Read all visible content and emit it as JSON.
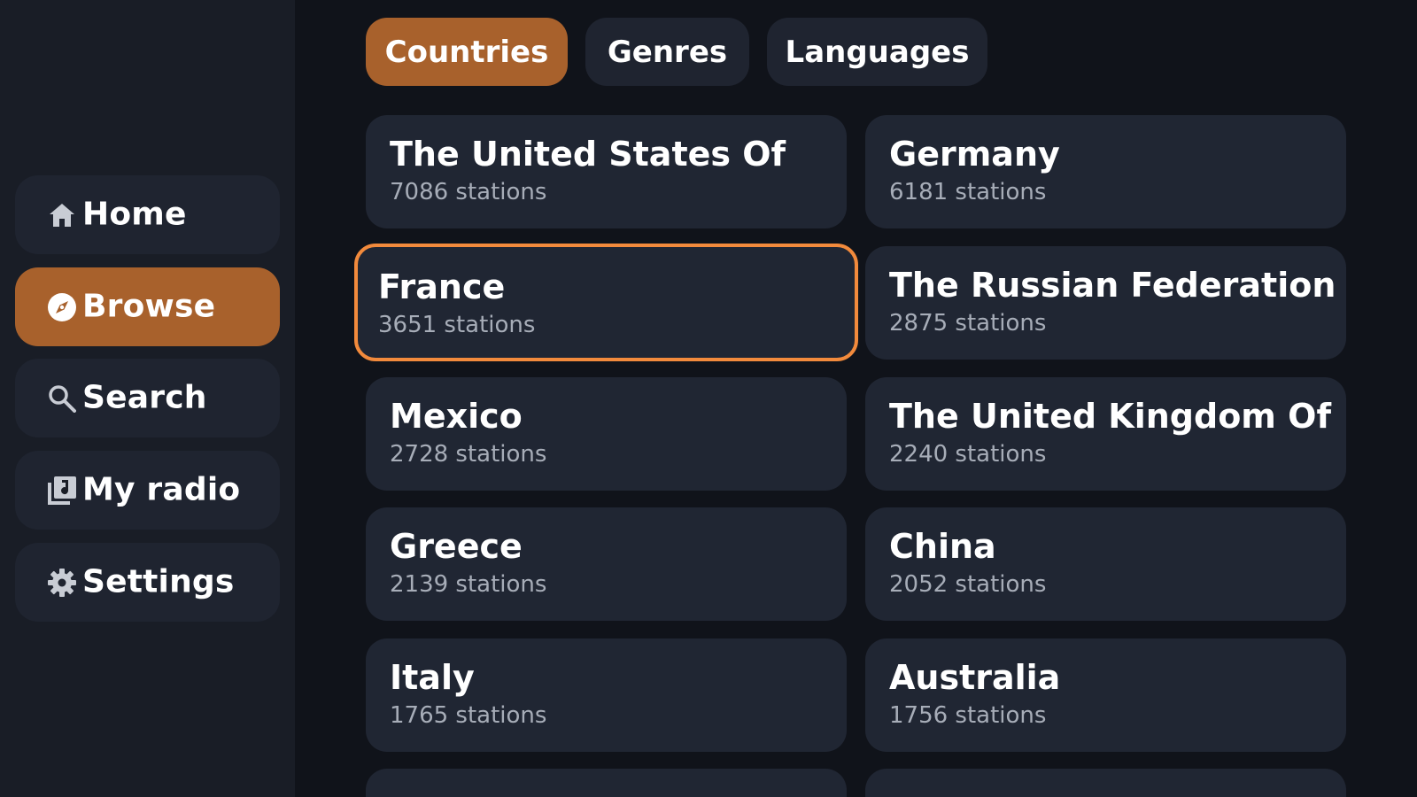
{
  "sidebar": {
    "items": [
      {
        "label": "Home",
        "icon": "home-icon"
      },
      {
        "label": "Browse",
        "icon": "compass-icon"
      },
      {
        "label": "Search",
        "icon": "search-icon"
      },
      {
        "label": "My radio",
        "icon": "library-icon"
      },
      {
        "label": "Settings",
        "icon": "gear-icon"
      }
    ],
    "active": "Browse"
  },
  "tabs": [
    {
      "label": "Countries"
    },
    {
      "label": "Genres"
    },
    {
      "label": "Languages"
    }
  ],
  "active_tab": "Countries",
  "countries": [
    {
      "name": "The United States Of",
      "count": "7086 stations"
    },
    {
      "name": "Germany",
      "count": "6181 stations"
    },
    {
      "name": "France",
      "count": "3651 stations"
    },
    {
      "name": "The Russian Federation",
      "count": "2875 stations"
    },
    {
      "name": "Mexico",
      "count": "2728 stations"
    },
    {
      "name": "The United Kingdom Of",
      "count": "2240 stations"
    },
    {
      "name": "Greece",
      "count": "2139 stations"
    },
    {
      "name": "China",
      "count": "2052 stations"
    },
    {
      "name": "Italy",
      "count": "1765 stations"
    },
    {
      "name": "Australia",
      "count": "1756 stations"
    }
  ],
  "focused_country": "France",
  "colors": {
    "accent": "#a8612c",
    "focus_ring": "#f28a3c",
    "background": "#10131a",
    "sidebar": "#191d26",
    "card": "#202633",
    "muted_text": "#a7adb8"
  }
}
